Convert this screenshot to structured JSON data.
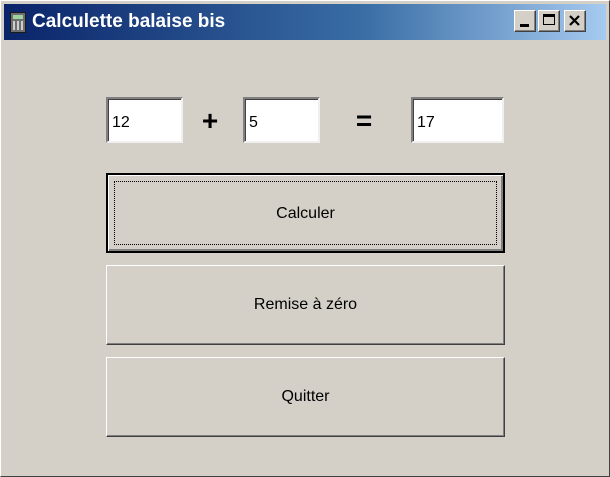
{
  "window": {
    "title": "Calculette balaise bis",
    "controls": {
      "minimize": "minimize-icon",
      "maximize": "maximize-icon",
      "close": "close-icon"
    },
    "colors": {
      "title_gradient_start": "#0a246a",
      "title_gradient_end": "#a6caf0",
      "face": "#d4d0c8"
    }
  },
  "calculator": {
    "operand_a": "12",
    "operator": "+",
    "operand_b": "5",
    "equals": "=",
    "result": "17"
  },
  "buttons": {
    "calculate": "Calculer",
    "reset": "Remise à zéro",
    "quit": "Quitter"
  }
}
